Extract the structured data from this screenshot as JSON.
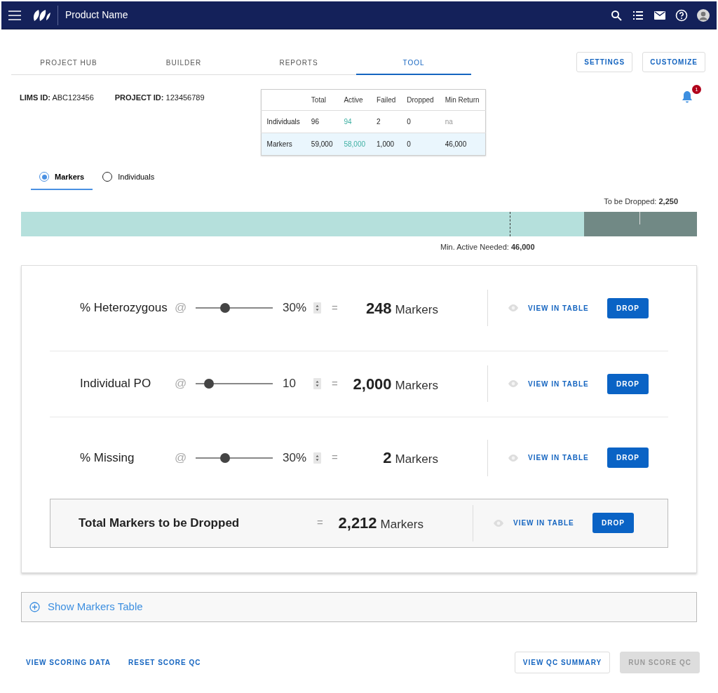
{
  "header": {
    "title": "Product Name"
  },
  "tabs": [
    {
      "label": "PROJECT HUB",
      "selected": false
    },
    {
      "label": "BUILDER",
      "selected": false
    },
    {
      "label": "REPORTS",
      "selected": false
    },
    {
      "label": "TOOL",
      "selected": true
    }
  ],
  "actions": [
    "SETTINGS",
    "CUSTOMIZE"
  ],
  "ids": [
    {
      "label": "LIMS ID:",
      "value": "ABC123456"
    },
    {
      "label": "PROJECT ID:",
      "value": "123456789"
    }
  ],
  "summary_table": {
    "columns": [
      "Total",
      "Active",
      "Failed",
      "Dropped",
      "Min Return"
    ],
    "rows": [
      {
        "label": "Individuals",
        "selected": false,
        "cells": [
          {
            "text": "96",
            "kind": "plain"
          },
          {
            "text": "94",
            "kind": "accent"
          },
          {
            "text": "2",
            "kind": "plain"
          },
          {
            "text": "0",
            "kind": "plain"
          },
          {
            "text": "na",
            "kind": "muted"
          }
        ]
      },
      {
        "label": "Markers",
        "selected": true,
        "cells": [
          {
            "text": "59,000",
            "kind": "plain"
          },
          {
            "text": "58,000",
            "kind": "accent"
          },
          {
            "text": "1,000",
            "kind": "plain"
          },
          {
            "text": "0",
            "kind": "plain"
          },
          {
            "text": "46,000",
            "kind": "plain"
          }
        ]
      }
    ]
  },
  "notification_count": "1",
  "view_toggle": [
    {
      "label": "Markers",
      "selected": true
    },
    {
      "label": "Individuals",
      "selected": false
    }
  ],
  "drop_bar": {
    "dropped_label": "To be Dropped:",
    "dropped_value": "2,250",
    "min_label": "Min. Active Needed:",
    "min_value": "46,000"
  },
  "filters": [
    {
      "label": "% Heterozygous",
      "at": "@",
      "level": 0.38,
      "value": "30%",
      "equals": "=",
      "count": "248",
      "unit": "Markers",
      "view": "VIEW IN TABLE",
      "drop": "DROP"
    },
    {
      "label": "Individual PO",
      "at": "@",
      "level": 0.17,
      "value": "10",
      "equals": "=",
      "count": "2,000",
      "unit": "Markers",
      "view": "VIEW IN TABLE",
      "drop": "DROP"
    },
    {
      "label": "% Missing",
      "at": "@",
      "level": 0.38,
      "value": "30%",
      "equals": "=",
      "count": "2",
      "unit": "Markers",
      "view": "VIEW IN TABLE",
      "drop": "DROP"
    }
  ],
  "total": {
    "label": "Total Markers to be Dropped",
    "equals": "=",
    "count": "2,212",
    "unit": "Markers",
    "view": "VIEW IN TABLE",
    "drop": "DROP"
  },
  "markers_table_toggle": "Show Markers Table",
  "footer_links": [
    "VIEW SCORING DATA",
    "RESET SCORE QC"
  ],
  "footer_buttons": [
    {
      "label": "VIEW QC SUMMARY",
      "disabled": false
    },
    {
      "label": "RUN SCORE QC",
      "disabled": true
    }
  ]
}
